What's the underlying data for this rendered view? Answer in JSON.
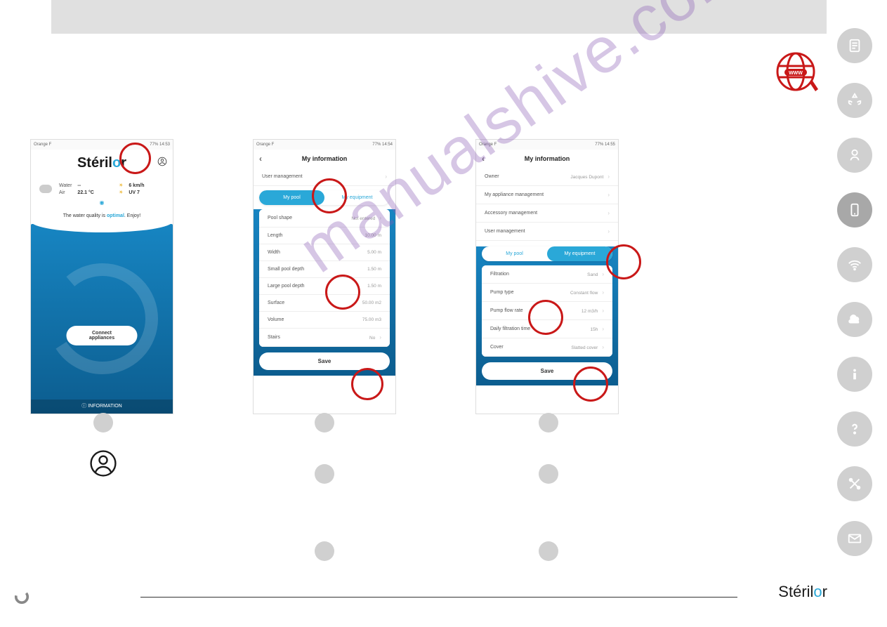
{
  "watermark": "manualshive.com",
  "statusbar": {
    "carrier": "Orange F",
    "signal": "77%",
    "time1": "14:53",
    "time2": "14:54",
    "time3": "14:55"
  },
  "phone1": {
    "logo": "Stéril",
    "water_label": "Water",
    "water_value": "--",
    "air_label": "Air",
    "air_value": "22.1 °C",
    "wind": "6 km/h",
    "uv": "UV 7",
    "quality_prefix": "The water quality is ",
    "quality_word": "optimal",
    "quality_suffix": ". Enjoy!",
    "connect": "Connect appliances",
    "info": "INFORMATION"
  },
  "phone2": {
    "title": "My information",
    "user_mgmt": "User management",
    "tab_pool": "My pool",
    "tab_equip": "My equipment",
    "rows": {
      "shape_label": "Pool shape",
      "shape_value": "Not entered",
      "length_label": "Length",
      "length_value": "10.00 m",
      "width_label": "Width",
      "width_value": "5.00 m",
      "smalldepth_label": "Small pool depth",
      "smalldepth_value": "1.50 m",
      "largedepth_label": "Large pool depth",
      "largedepth_value": "1.50 m",
      "surface_label": "Surface",
      "surface_value": "50.00 m2",
      "volume_label": "Volume",
      "volume_value": "75.00 m3",
      "stairs_label": "Stairs",
      "stairs_value": "No"
    },
    "save": "Save"
  },
  "phone3": {
    "title": "My information",
    "owner_label": "Owner",
    "owner_value": "Jacques Dupont",
    "appliance_mgmt": "My appliance management",
    "accessory_mgmt": "Accessory management",
    "user_mgmt": "User management",
    "tab_pool": "My pool",
    "tab_equip": "My equipment",
    "rows": {
      "filtration_label": "Filtration",
      "filtration_value": "Sand",
      "pumptype_label": "Pump type",
      "pumptype_value": "Constant flow",
      "pumpflow_label": "Pump flow rate",
      "pumpflow_value": "12 m3/h",
      "filttime_label": "Daily filtration time",
      "filttime_value": "15h",
      "cover_label": "Cover",
      "cover_value": "Slatted cover"
    },
    "save": "Save"
  },
  "footer_logo": "Stéril"
}
